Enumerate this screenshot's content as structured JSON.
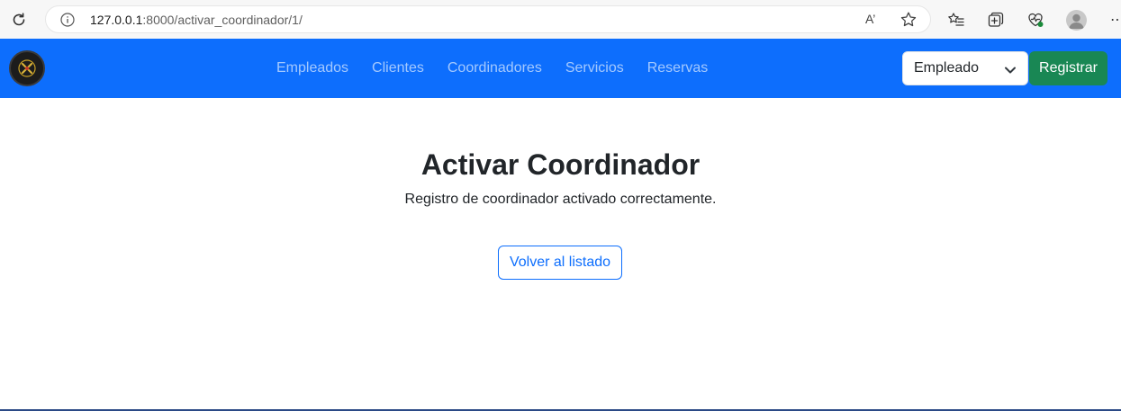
{
  "browser": {
    "url_host": "127.0.0.1",
    "url_path": ":8000/activar_coordinador/1/",
    "icons": [
      "reload-icon",
      "info-icon",
      "read-aloud-icon",
      "favorite-star-icon",
      "favorites-list-icon",
      "collections-icon",
      "browser-essentials-icon",
      "profile-avatar",
      "more-icon"
    ],
    "read_aloud_label": "A’"
  },
  "navbar": {
    "background": "#0d6efd",
    "links": [
      "Empleados",
      "Clientes",
      "Coordinadores",
      "Servicios",
      "Reservas"
    ],
    "select_value": "Empleado",
    "register_label": "Registrar",
    "register_color": "#198754"
  },
  "main": {
    "title": "Activar Coordinador",
    "message": "Registro de coordinador activado correctamente.",
    "back_label": "Volver al listado",
    "accent": "#0d6efd"
  }
}
